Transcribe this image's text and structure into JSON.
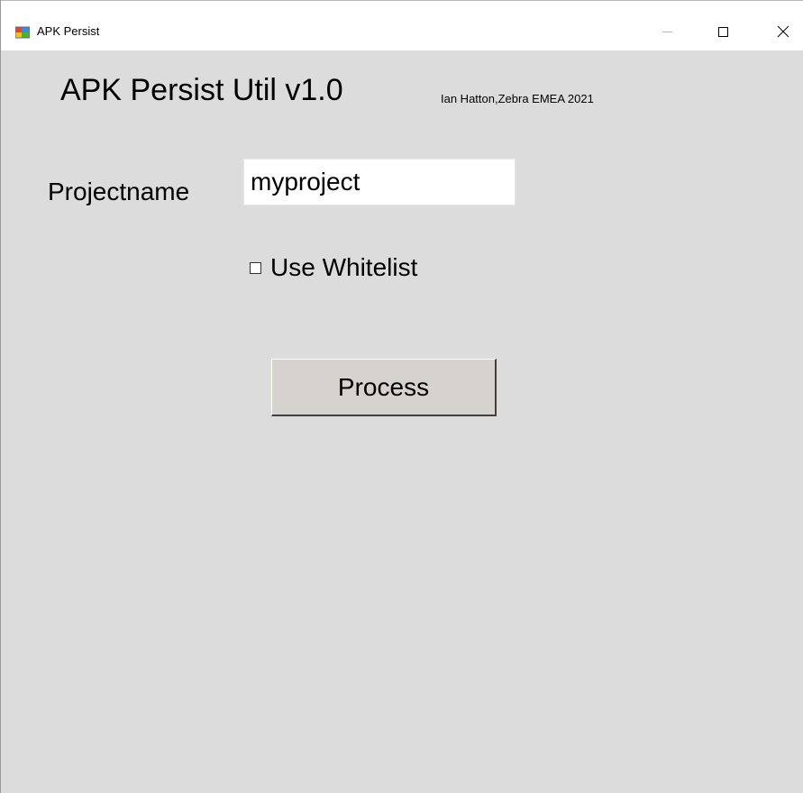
{
  "window": {
    "title": "APK Persist",
    "icon": "windows-form-app-icon"
  },
  "controls": {
    "minimize_icon": "minimize-icon",
    "maximize_icon": "maximize-icon",
    "close_icon": "close-icon",
    "close_glyph": "✕"
  },
  "main": {
    "heading": "APK Persist Util v1.0",
    "credit": "Ian Hatton,Zebra EMEA 2021",
    "project_label": "Projectname",
    "project_value": "myproject",
    "whitelist_label": "Use Whitelist",
    "whitelist_checked": false,
    "process_label": "Process"
  },
  "colors": {
    "window_bg": "#dcdcdc",
    "titlebar_bg": "#ffffff",
    "button_face": "#d6d3ce"
  }
}
